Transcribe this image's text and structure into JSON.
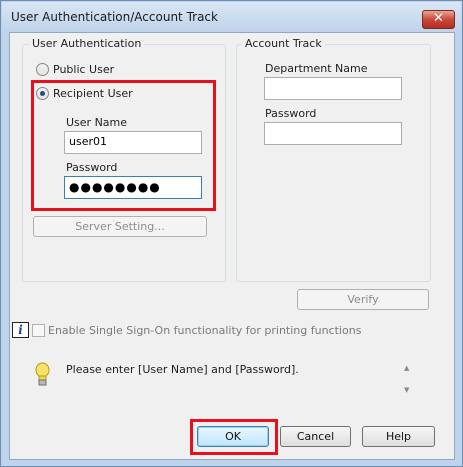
{
  "window": {
    "title": "User Authentication/Account Track"
  },
  "icons": {
    "close": "close-icon",
    "info": "info-icon",
    "hint": "lightbulb-icon"
  },
  "colors": {
    "highlight": "#e8101a",
    "accent": "#3c7fb1"
  },
  "user_auth": {
    "group_label": "User Authentication",
    "public_user_label": "Public User",
    "recipient_user_label": "Recipient User",
    "selected": "Recipient User",
    "user_name_label": "User Name",
    "user_name_value": "user01",
    "password_label": "Password",
    "password_value": "●●●●●●●●",
    "server_setting_label": "Server Setting..."
  },
  "account_track": {
    "group_label": "Account Track",
    "department_name_label": "Department Name",
    "department_name_value": "",
    "password_label": "Password",
    "password_value": "",
    "verify_label": "Verify"
  },
  "sso": {
    "label": "Enable Single Sign-On functionality for printing functions",
    "checked": false
  },
  "message": {
    "text": "Please enter [User Name] and [Password]."
  },
  "buttons": {
    "ok": "OK",
    "cancel": "Cancel",
    "help": "Help"
  }
}
